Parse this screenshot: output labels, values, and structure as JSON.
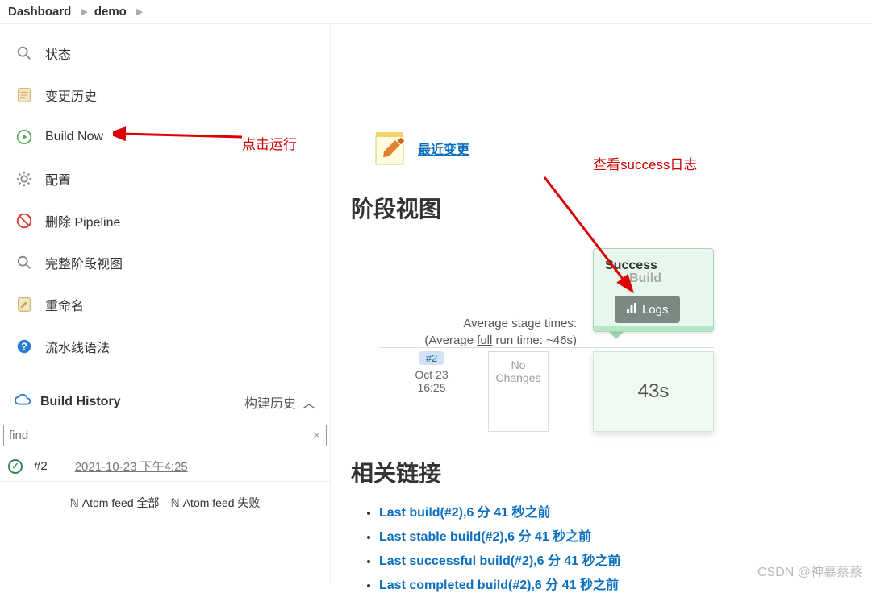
{
  "breadcrumb": {
    "dashboard": "Dashboard",
    "project": "demo"
  },
  "sidebar": {
    "items": [
      {
        "label": "状态"
      },
      {
        "label": "变更历史"
      },
      {
        "label": "Build Now"
      },
      {
        "label": "配置"
      },
      {
        "label": "删除 Pipeline"
      },
      {
        "label": "完整阶段视图"
      },
      {
        "label": "重命名"
      },
      {
        "label": "流水线语法"
      }
    ],
    "history_title": "Build History",
    "history_sub": "构建历史",
    "find_placeholder": "find",
    "build": {
      "num": "#2",
      "date": "2021-10-23 下午4:25"
    },
    "feed_all": "Atom feed 全部",
    "feed_fail": "Atom feed 失败"
  },
  "annotations": {
    "run": "点击运行",
    "logs": "查看success日志"
  },
  "main": {
    "recent_changes": "最近变更",
    "stage_view": "阶段视图",
    "avg_stage": "Average stage times:",
    "avg_full_pre": "(Average ",
    "avg_full_mid": "full",
    "avg_full_post": " run time: ~46s)",
    "success": "Success",
    "build": "Build",
    "logs_btn": "Logs",
    "build_badge": "#2",
    "build_date": "Oct 23",
    "build_time": "16:25",
    "no_changes": "No Changes",
    "stage_time": "43s",
    "related_links": "相关链接",
    "links": [
      "Last build(#2),6 分 41 秒之前",
      "Last stable build(#2),6 分 41 秒之前",
      "Last successful build(#2),6 分 41 秒之前",
      "Last completed build(#2),6 分 41 秒之前"
    ]
  },
  "watermark": "CSDN @神慕蔡蔡"
}
